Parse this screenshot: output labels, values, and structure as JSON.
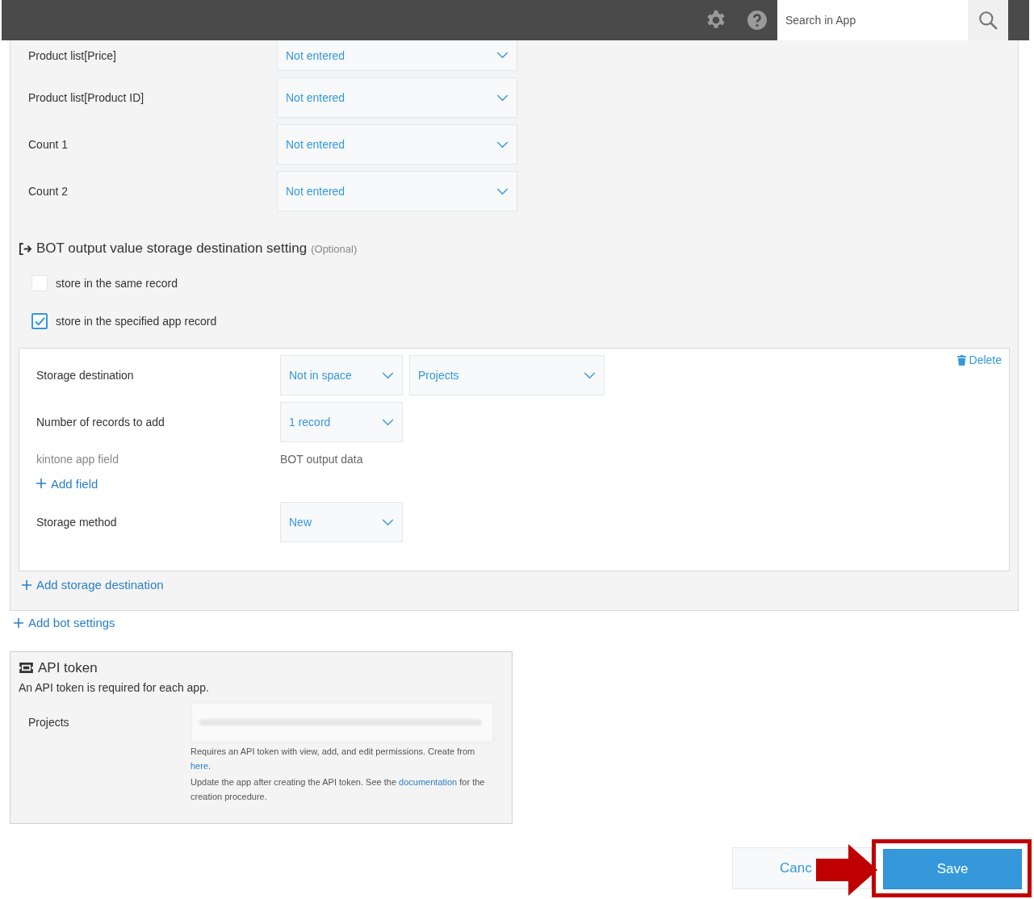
{
  "header": {
    "search": {
      "placeholder": "Search in App"
    }
  },
  "mapping_rows": [
    {
      "label": "Product list[Price]",
      "value": "Not entered"
    },
    {
      "label": "Product list[Product ID]",
      "value": "Not entered"
    },
    {
      "label": "Count 1",
      "value": "Not entered"
    },
    {
      "label": "Count 2",
      "value": "Not entered"
    }
  ],
  "output_section": {
    "title": "BOT output value storage destination setting",
    "note": "(Optional)",
    "options": [
      {
        "label": "store in the same record",
        "checked": false
      },
      {
        "label": "store in the specified app record",
        "checked": true
      }
    ],
    "destination": {
      "delete": "Delete",
      "rows": [
        {
          "kind": "select",
          "label": "Storage destination",
          "selects": [
            "Not in space",
            "Projects"
          ]
        },
        {
          "kind": "select",
          "label": "Number of records to add",
          "selects": [
            "1 record"
          ]
        },
        {
          "kind": "header",
          "label": "kintone app field",
          "value": "BOT output data"
        },
        {
          "kind": "link",
          "label": "Add field"
        },
        {
          "kind": "select",
          "label": "Storage method",
          "selects": [
            "New"
          ]
        }
      ]
    },
    "add_destination": "Add storage destination"
  },
  "add_bot": "Add bot settings",
  "api_token": {
    "title": "API token",
    "description": "An API token is required for each app.",
    "rows": [
      {
        "label": "Projects",
        "help": [
          {
            "text": "Requires an API token with view, add, and edit permissions. Create from",
            "link": "here",
            "after": "."
          },
          {
            "text": "Update the app after creating the API token. See the",
            "link": "documentation",
            "after": "for the creation procedure."
          }
        ]
      }
    ]
  },
  "buttons": {
    "cancel": "Canc",
    "save": "Save"
  }
}
